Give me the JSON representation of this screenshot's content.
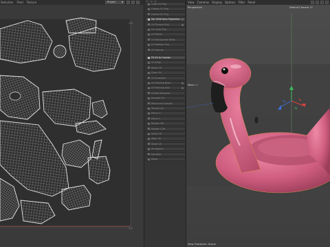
{
  "uv_editor": {
    "menu": [
      "Selection",
      "Pixel",
      "Texture"
    ],
    "projection_select": "Project",
    "corner_top": "1,0",
    "corner_bottom": "1,0"
  },
  "commands": {
    "items": [
      {
        "label": "Cube UV Proj",
        "highlight": false,
        "radio": false
      },
      {
        "label": "Flatten UV Proj",
        "highlight": false,
        "radio": false
      },
      {
        "label": "Frontal UV Proj",
        "highlight": false,
        "radio": false
      },
      {
        "label": "Set UVW from Projection",
        "highlight": true,
        "radio": true
      },
      {
        "label": "UV Terrace Proj",
        "highlight": false,
        "radio": true
      },
      {
        "label": "UV Cube Proj",
        "highlight": false,
        "radio": false
      },
      {
        "label": "UV Mirror",
        "highlight": false,
        "radio": false
      },
      {
        "label": "UV Manipulate Relax",
        "highlight": false,
        "radio": false
      },
      {
        "label": "UV Realign Proj",
        "highlight": false,
        "radio": false
      },
      {
        "label": "UV Remap",
        "highlight": false,
        "radio": false
      },
      {
        "label": "Fit UV to Canvas",
        "highlight": true,
        "radio": false
      },
      {
        "label": "UV Snap",
        "highlight": false,
        "radio": false
      },
      {
        "label": "Relax UV",
        "highlight": false,
        "radio": false
      },
      {
        "label": "Clear UV",
        "highlight": false,
        "radio": false
      },
      {
        "label": "UV Quantize",
        "highlight": false,
        "radio": false
      },
      {
        "label": "UV Packing Bbox",
        "highlight": false,
        "radio": true
      },
      {
        "label": "UV Packing Geo",
        "highlight": false,
        "radio": true
      },
      {
        "label": "Unfold Selection",
        "highlight": false,
        "radio": false
      },
      {
        "label": "Smooth UV",
        "highlight": false,
        "radio": false
      },
      {
        "label": "Reconnect Islands",
        "highlight": false,
        "radio": false
      },
      {
        "label": "Terrace All",
        "highlight": false,
        "radio": false
      },
      {
        "label": "Mirror U",
        "highlight": false,
        "radio": false
      },
      {
        "label": "Mirror V",
        "highlight": false,
        "radio": false
      },
      {
        "label": "Rotate CW",
        "highlight": false,
        "radio": false
      },
      {
        "label": "Rotate CCW",
        "highlight": false,
        "radio": false
      },
      {
        "label": "Scale UV",
        "highlight": false,
        "radio": false
      },
      {
        "label": "Align UV",
        "highlight": false,
        "radio": false
      },
      {
        "label": "Stack UV",
        "highlight": false,
        "radio": false
      },
      {
        "label": "Straighten",
        "highlight": false,
        "radio": false
      },
      {
        "label": "Equalize",
        "highlight": false,
        "radio": false
      },
      {
        "label": "Reset",
        "highlight": false,
        "radio": false
      }
    ]
  },
  "viewport": {
    "menu": [
      "View",
      "Cameras",
      "Display",
      "Options",
      "Filter",
      "Panel"
    ],
    "label": "Perspective",
    "camera": "Default Camera !!!",
    "move_label": "Move ∙∙",
    "footer": "View Transform: Scene"
  },
  "colors": {
    "flamingo": "#cf5d7f",
    "uv_bg": "#3a3a3a",
    "viewport_bg": "#474747",
    "axis_y": "#3fbf5f",
    "axis_x": "#e04040",
    "axis_z": "#3f6fd8"
  }
}
